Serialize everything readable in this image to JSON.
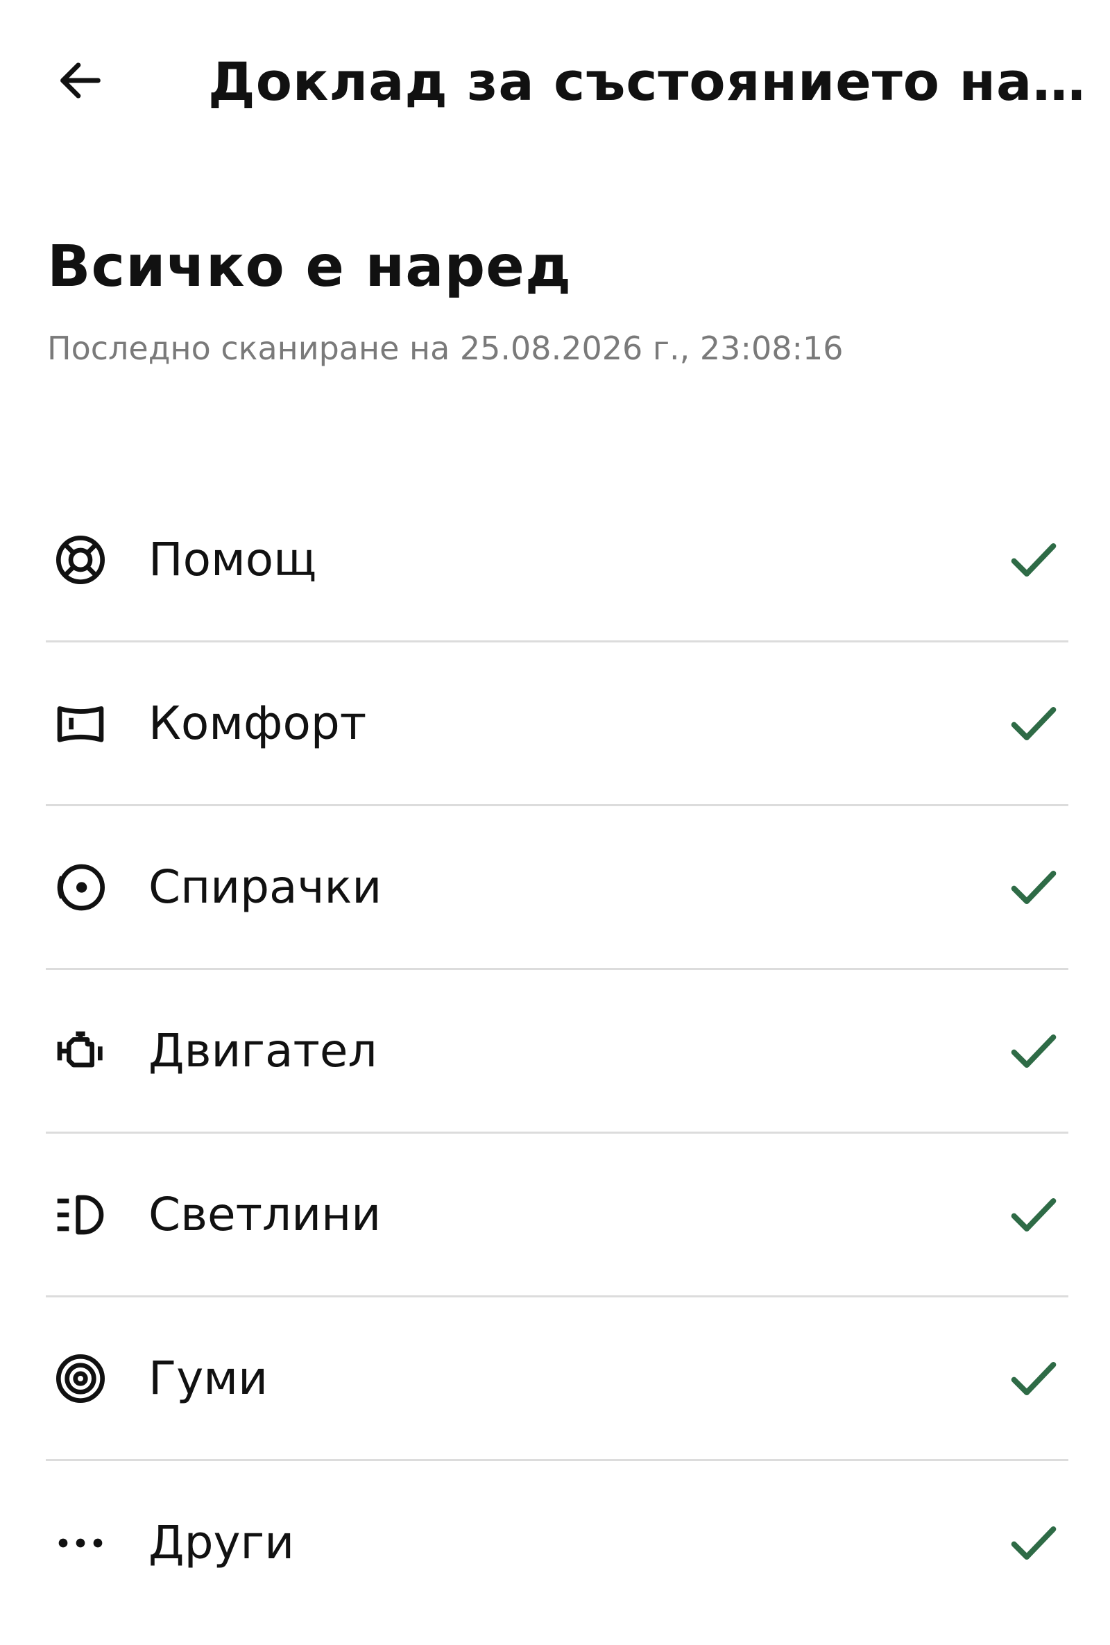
{
  "header": {
    "back_icon": "arrow-left-icon",
    "title": "Доклад за състоянието на ав..."
  },
  "summary": {
    "status": "Всичко е наред",
    "last_scan": "Последно сканиране на 25.08.2026 г., 23:08:16"
  },
  "colors": {
    "check": "#2e6b46",
    "divider": "#dcdcdc",
    "muted_text": "#7a7a7a"
  },
  "items": [
    {
      "label": "Помощ",
      "icon": "lifebuoy-icon",
      "status_icon": "check-icon"
    },
    {
      "label": "Комфорт",
      "icon": "seat-comfort-icon",
      "status_icon": "check-icon"
    },
    {
      "label": "Спирачки",
      "icon": "brake-disc-icon",
      "status_icon": "check-icon"
    },
    {
      "label": "Двигател",
      "icon": "engine-icon",
      "status_icon": "check-icon"
    },
    {
      "label": "Светлини",
      "icon": "headlight-icon",
      "status_icon": "check-icon"
    },
    {
      "label": "Гуми",
      "icon": "tire-icon",
      "status_icon": "check-icon"
    },
    {
      "label": "Други",
      "icon": "more-dots-icon",
      "status_icon": "check-icon"
    }
  ]
}
